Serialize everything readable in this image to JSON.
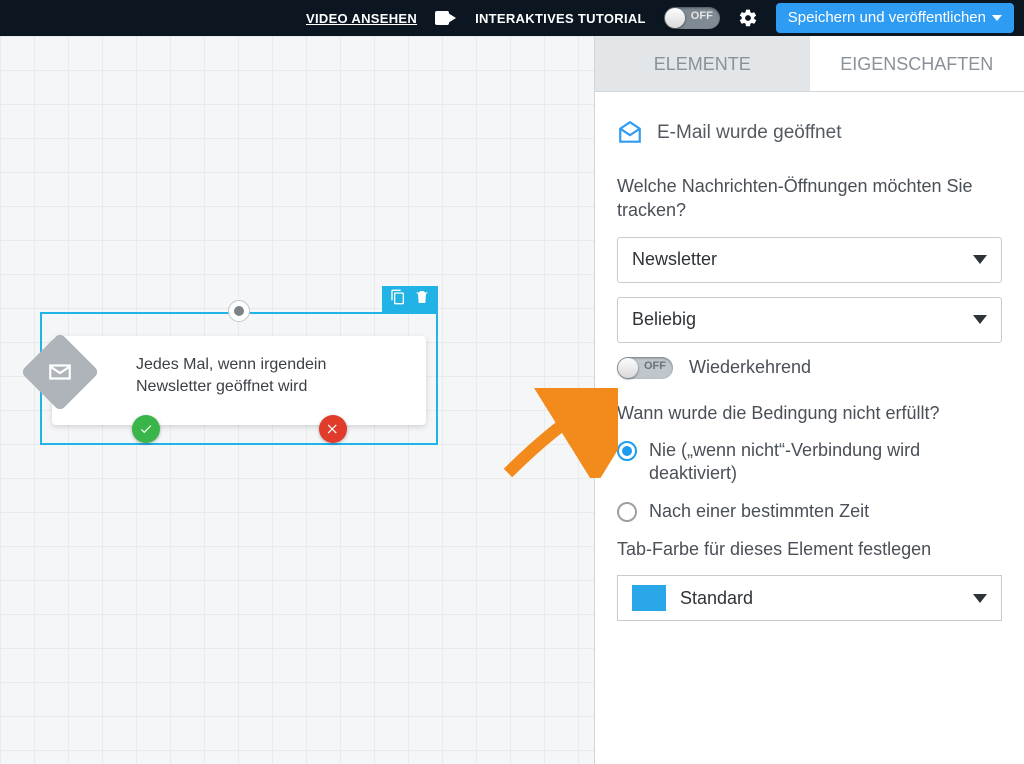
{
  "topbar": {
    "video_link": "VIDEO ANSEHEN",
    "tutorial_label": "INTERAKTIVES TUTORIAL",
    "tutorial_toggle": "OFF",
    "publish_label": "Speichern und veröffentlichen"
  },
  "canvas": {
    "node_text": "Jedes Mal, wenn irgendein Newsletter geöffnet wird"
  },
  "panel": {
    "tabs": {
      "elements": "ELEMENTE",
      "properties": "EIGENSCHAFTEN"
    },
    "title": "E-Mail wurde geöffnet",
    "q_track": "Welche Nachrichten-Öffnungen möchten Sie tracken?",
    "select_type": "Newsletter",
    "select_which": "Beliebig",
    "recurring_toggle": "OFF",
    "recurring_label": "Wiederkehrend",
    "q_notmet": "Wann wurde die Bedingung nicht erfüllt?",
    "radio_never": "Nie („wenn nicht“-Verbindung wird deaktiviert)",
    "radio_after": "Nach einer bestimmten Zeit",
    "q_color": "Tab-Farbe für dieses Element festlegen",
    "color_label": "Standard",
    "color_hex": "#29a7e8"
  }
}
